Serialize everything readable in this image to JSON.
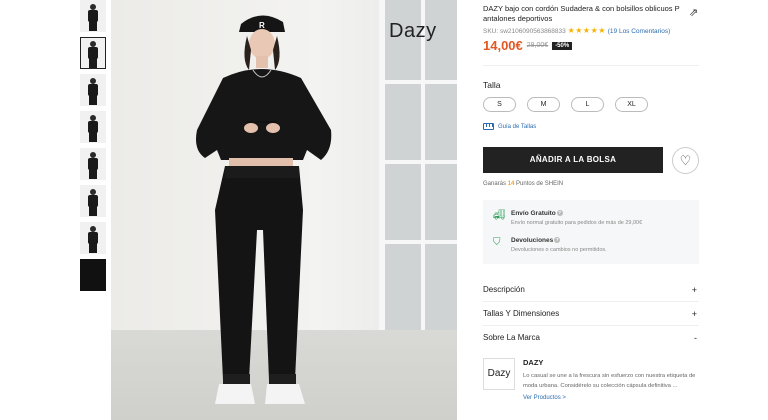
{
  "product": {
    "title": "DAZY bajo con cordón Sudadera & con bolsillos oblicuos P antalones deportivos",
    "sku_label": "SKU: sw2106090563868833",
    "rating_stars": "★★★★★",
    "reviews": "(19 Los Comentarios)",
    "price": "14,00€",
    "old_price": "28,00€",
    "discount": "-50%",
    "share_icon": "share-icon"
  },
  "photo": {
    "brand_mark": "Dazy"
  },
  "sizes": {
    "label": "Talla",
    "options": [
      "S",
      "M",
      "L",
      "XL"
    ],
    "guide": "Guía de Tallas"
  },
  "actions": {
    "add_to_bag": "AÑADIR A LA BOLSA",
    "wishlist_icon": "heart-icon",
    "points_prefix": "Ganarás",
    "points_value": "14",
    "points_suffix": "Puntos de SHEIN"
  },
  "info": {
    "shipping_title": "Envío Gratuito",
    "shipping_desc": "Envío normal gratuito para pedidos de más de 29,00€",
    "returns_title": "Devoluciones",
    "returns_desc": "Devoluciones o cambios no permitidos."
  },
  "accordions": [
    {
      "label": "Descripción",
      "sign": "+"
    },
    {
      "label": "Tallas Y Dimensiones",
      "sign": "+"
    },
    {
      "label": "Sobre La Marca",
      "sign": "-"
    }
  ],
  "brand": {
    "logo": "Dazy",
    "name": "DAZY",
    "desc": "Lo casual se une a la frescura sin esfuerzo con nuestra etiqueta de moda urbana. Considérelo su colección cápsula definitiva ...",
    "link": "Ver Productos >"
  },
  "colors": {
    "price": "#e25822",
    "accent_link": "#2b6cb0",
    "star": "#f5b301",
    "button": "#222222"
  }
}
